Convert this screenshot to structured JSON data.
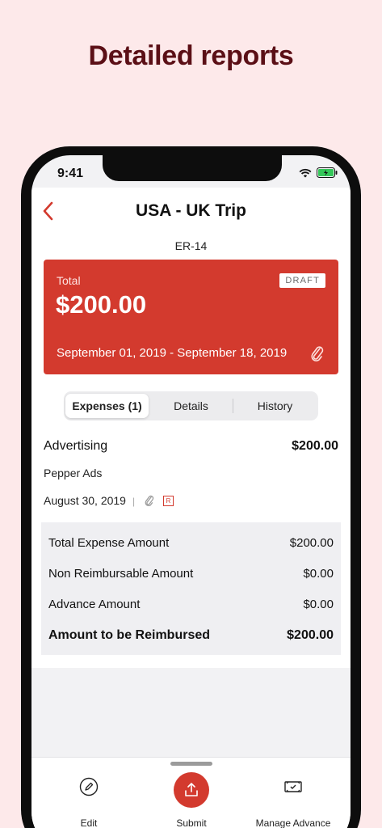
{
  "headline": "Detailed reports",
  "status_bar": {
    "time": "9:41",
    "icons": [
      "wifi-icon",
      "battery-icon"
    ]
  },
  "nav": {
    "title": "USA - UK Trip",
    "back_icon": "chevron-left-icon"
  },
  "report": {
    "id": "ER-14",
    "total_label": "Total",
    "total_amount": "$200.00",
    "status": "DRAFT",
    "date_range": "September 01, 2019 - September 18, 2019",
    "attach_icon": "paperclip-icon"
  },
  "tabs": [
    {
      "label": "Expenses (1)",
      "active": true
    },
    {
      "label": "Details",
      "active": false
    },
    {
      "label": "History",
      "active": false
    }
  ],
  "expense": {
    "category": "Advertising",
    "amount": "$200.00",
    "merchant": "Pepper Ads",
    "date": "August 30, 2019",
    "separator": "|",
    "receipt_badge": "R"
  },
  "summary": [
    {
      "label": "Total Expense Amount",
      "value": "$200.00"
    },
    {
      "label": "Non Reimbursable Amount",
      "value": "$0.00"
    },
    {
      "label": "Advance Amount",
      "value": "$0.00"
    },
    {
      "label": "Amount to be Reimbursed",
      "value": "$200.00"
    }
  ],
  "bottom_bar": {
    "edit_label": "Edit",
    "submit_label": "Submit",
    "advance_label": "Manage Advance"
  },
  "colors": {
    "background": "#fde9ea",
    "headline": "#5b0f16",
    "accent": "#d33a2e"
  }
}
